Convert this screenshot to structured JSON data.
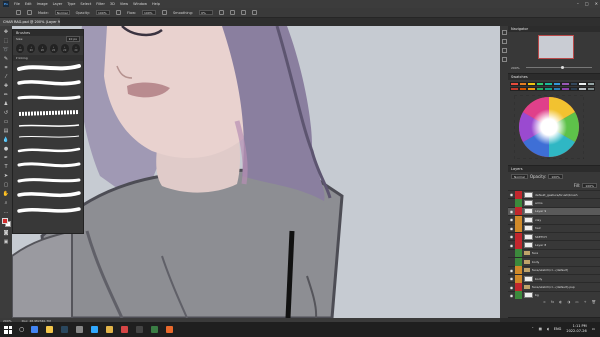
{
  "app": {
    "logo": "Ps",
    "menus": [
      "File",
      "Edit",
      "Image",
      "Layer",
      "Type",
      "Select",
      "Filter",
      "3D",
      "View",
      "Window",
      "Help"
    ]
  },
  "options_bar": {
    "mode_label": "Mode:",
    "mode_value": "Normal",
    "opacity_label": "Opacity:",
    "opacity_value": "100%",
    "flow_label": "Flow:",
    "flow_value": "100%",
    "smoothing_label": "Smoothing:",
    "smoothing_value": "0%"
  },
  "document": {
    "tab_title": "CHAR RAG.psd @ 200% (Layer 9, RGB/8*)"
  },
  "brushes_panel": {
    "title": "Brushes",
    "size_label": "Size:",
    "size_value": "10 px",
    "presets": [
      {
        "icon": "brush-preset-icon",
        "size": "20"
      },
      {
        "icon": "brush-preset-icon",
        "size": "20"
      },
      {
        "icon": "brush-preset-icon",
        "size": "20"
      },
      {
        "icon": "brush-preset-icon",
        "size": "20"
      },
      {
        "icon": "brush-preset-icon",
        "size": "20"
      },
      {
        "icon": "brush-preset-icon",
        "size": "20"
      }
    ],
    "folder_label": "Inking"
  },
  "navigator": {
    "title": "Navigator",
    "zoom": "200%",
    "zoom_fraction": 0.55
  },
  "swatches": {
    "title": "Swatches",
    "colors": [
      "#e74c3c",
      "#e67e22",
      "#f1c40f",
      "#2ecc71",
      "#1abc9c",
      "#3498db",
      "#9b59b6",
      "#34495e",
      "#ecf0f1",
      "#95a5a6",
      "#c0392b",
      "#d35400",
      "#f39c12",
      "#27ae60",
      "#16a085",
      "#2980b9",
      "#8e44ad",
      "#2c3e50",
      "#bdc3c7",
      "#7f8c8d"
    ]
  },
  "layers": {
    "title": "Layers",
    "blend_mode": "Normal",
    "opacity_label": "Opacity:",
    "opacity_value": "100%",
    "fill_label": "Fill:",
    "fill_value": "100%",
    "items": [
      {
        "name": "default_gesture/brush/brush",
        "color": "#c1272d",
        "visible": true,
        "kind": "layer",
        "active": false
      },
      {
        "name": "arms",
        "color": "#3c8a3c",
        "visible": false,
        "kind": "layer",
        "active": false
      },
      {
        "name": "Layer 9",
        "color": "#c1272d",
        "visible": true,
        "kind": "layer",
        "active": true
      },
      {
        "name": "clay",
        "color": "#d08a2a",
        "visible": true,
        "kind": "layer",
        "active": false
      },
      {
        "name": "hair",
        "color": "#d08a2a",
        "visible": true,
        "kind": "layer",
        "active": false
      },
      {
        "name": "SKETCH",
        "color": "#c1272d",
        "visible": true,
        "kind": "layer",
        "active": false
      },
      {
        "name": "Layer 8",
        "color": "#c1272d",
        "visible": true,
        "kind": "layer",
        "active": false
      },
      {
        "name": "face",
        "color": "#3c8a3c",
        "visible": false,
        "kind": "folder",
        "active": false
      },
      {
        "name": "body",
        "color": "#3c8a3c",
        "visible": false,
        "kind": "folder",
        "active": false
      },
      {
        "name": "face/sketch/cl...(default)",
        "color": "#d08a2a",
        "visible": true,
        "kind": "folder",
        "active": false
      },
      {
        "name": "body",
        "color": "#d08a2a",
        "visible": true,
        "kind": "layer",
        "active": false
      },
      {
        "name": "face/sketch/cl...(default).psp",
        "color": "#c1272d",
        "visible": true,
        "kind": "folder",
        "active": false
      },
      {
        "name": "bg",
        "color": "#3c8a3c",
        "visible": true,
        "kind": "layer",
        "active": false
      }
    ],
    "footer_icons": [
      "link-icon",
      "fx-icon",
      "mask-icon",
      "adjustment-icon",
      "group-icon",
      "new-layer-icon",
      "trash-icon"
    ]
  },
  "status_bar": {
    "zoom": "200%",
    "doc_info": "Doc: 48.9M/340.7M"
  },
  "taskbar": {
    "apps": [
      {
        "icon": "chrome-icon",
        "color": "#4285f4"
      },
      {
        "icon": "file-explorer-icon",
        "color": "#f3c64b"
      },
      {
        "icon": "steam-icon",
        "color": "#2a475e"
      },
      {
        "icon": "settings-icon",
        "color": "#888888"
      },
      {
        "icon": "photoshop-icon",
        "color": "#31a8ff"
      },
      {
        "icon": "folder-icon",
        "color": "#e2b44a"
      },
      {
        "icon": "media-icon",
        "color": "#d64545"
      },
      {
        "icon": "obs-icon",
        "color": "#444444"
      },
      {
        "icon": "app-icon",
        "color": "#3a7d44"
      },
      {
        "icon": "app-icon",
        "color": "#e9692c"
      }
    ],
    "tray_lang": "ENG",
    "time": "1:11 PM",
    "date": "2022-07-26"
  }
}
